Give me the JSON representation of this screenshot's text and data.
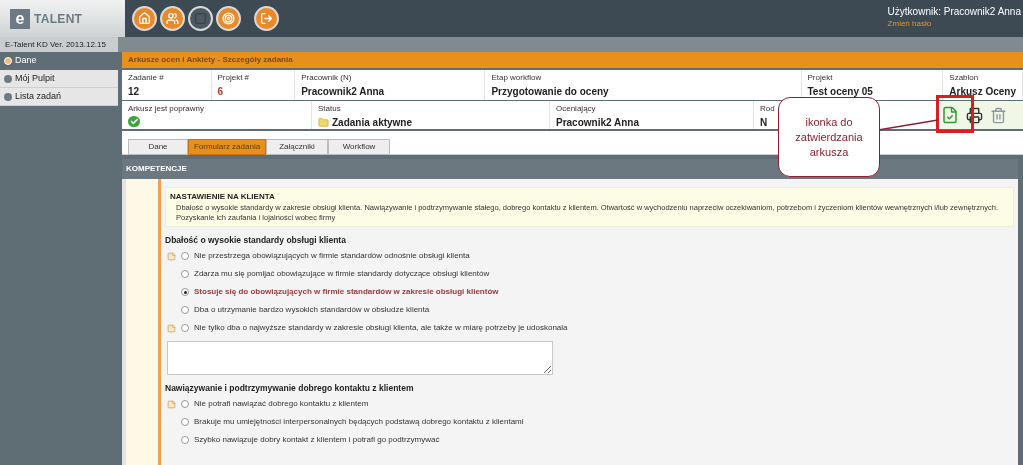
{
  "header": {
    "logo_letter": "e",
    "logo_text": "TALENT",
    "version": "E-Talent KD Ver. 2013.12.15",
    "user": "Użytkownik: Pracownik2 Anna",
    "change_password": "Zmień hasło"
  },
  "sidebar": {
    "items": [
      {
        "label": "Dane",
        "selected": true
      },
      {
        "label": "Mój Pulpit",
        "selected": false
      },
      {
        "label": "Lista zadań",
        "selected": false
      }
    ]
  },
  "page_title": "Arkusze ocen i Ankiety - Szczegóły zadania",
  "info_row_1": [
    {
      "label": "Zadanie #",
      "value": "12",
      "kind": "text"
    },
    {
      "label": "Projekt #",
      "value": "6",
      "kind": "highlight"
    },
    {
      "label": "Pracownik (N)",
      "value": "Pracownik2 Anna",
      "kind": "text"
    },
    {
      "label": "Etap workflow",
      "value": "Przygotowanie do oceny",
      "kind": "text"
    },
    {
      "label": "Projekt",
      "value": "Test oceny 05",
      "kind": "text"
    },
    {
      "label": "Szablon",
      "value": "Arkusz Oceny",
      "kind": "text"
    }
  ],
  "info_row_2": [
    {
      "label": "Arkusz jest poprawny",
      "kind": "check"
    },
    {
      "label": "Status",
      "value": "Zadania aktywne",
      "kind": "status"
    },
    {
      "label": "Oceniający",
      "value": "Pracownik2 Anna",
      "kind": "text"
    },
    {
      "label": "Rod",
      "value": "N",
      "kind": "text"
    }
  ],
  "tabs": [
    {
      "label": "Dane",
      "selected": false
    },
    {
      "label": "Formularz zadania",
      "selected": true
    },
    {
      "label": "Załączniki",
      "selected": false
    },
    {
      "label": "Workflow",
      "selected": false
    }
  ],
  "section_title": "KOMPETENCJE",
  "competency": {
    "title": "NASTAWIENIE NA KLIENTA",
    "description": "Dbałość o wysokie standardy w zakresie obsługi klienta. Nawiązywanie i podtrzymywanie stałego, dobrego kontaktu z klientem. Otwartość w wychodzeniu naprzeciw oczekiwaniom, potrzebom i życzeniom klientów wewnętrznych i/lub zewnętrznych.  Pozyskanie ich zaufania i lojalności wobec firmy"
  },
  "questions": [
    {
      "title": "Dbałość o wysokie standardy obsługi klienta",
      "comment_box": true,
      "options": [
        {
          "label": "Nie przestrzega obowiązujących w firmie standardów odnośnie obsługi klienta",
          "selected": false,
          "note": true
        },
        {
          "label": "Zdarza mu się pomijać obowiązujące w firmie standardy dotyczące obsługi klientów",
          "selected": false,
          "note": false
        },
        {
          "label": "Stosuje się do obowiązujących w firmie standardów w zakresie obsługi klientów",
          "selected": true,
          "note": false
        },
        {
          "label": "Dba o utrzymanie bardzo wysokich standardów w obsłudze klienta",
          "selected": false,
          "note": false
        },
        {
          "label": "Nie tylko dba o najwyższe standardy w zakresie  obsługi klienta, ale także w miarę potrzeby je udoskonala",
          "selected": false,
          "note": true
        }
      ]
    },
    {
      "title": "Nawiązywanie i podtrzymywanie dobrego kontaktu z klientem",
      "comment_box": false,
      "options": [
        {
          "label": "Nie potrafi nawiązać dobrego kontaktu z klientem",
          "selected": false,
          "note": true
        },
        {
          "label": "Brakuje mu umiejętności interpersonalnych będących podstawą dobrego kontaktu z klientami",
          "selected": false,
          "note": false
        },
        {
          "label": "Szybko nawiązuje dobry kontakt z klientem i potrafi go podtrzymywać",
          "selected": false,
          "note": false
        }
      ]
    }
  ],
  "callout": {
    "text": "ikonka do zatwierdzania arkusza"
  }
}
